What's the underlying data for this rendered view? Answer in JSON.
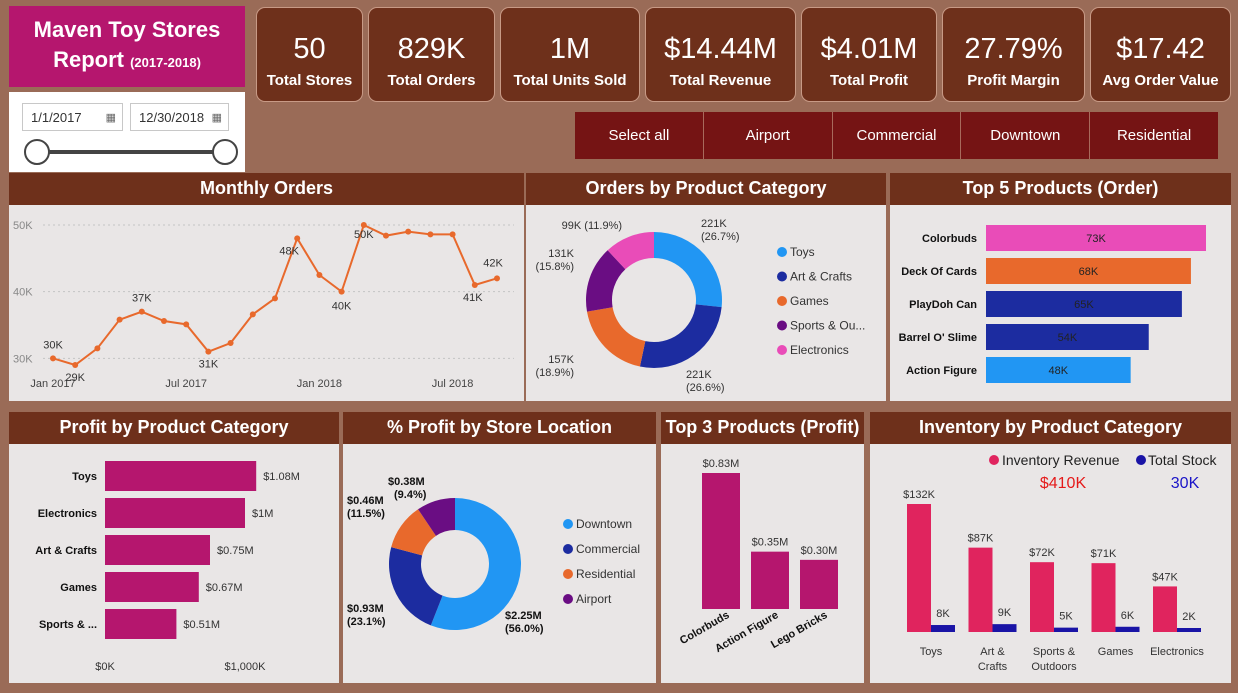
{
  "header": {
    "title_line1": "Maven Toy Stores",
    "title_line2": "Report",
    "title_years": "(2017-2018)"
  },
  "date_filter": {
    "start": "1/1/2017",
    "end": "12/30/2018"
  },
  "kpis": [
    {
      "value": "50",
      "label": "Total Stores"
    },
    {
      "value": "829K",
      "label": "Total Orders"
    },
    {
      "value": "1M",
      "label": "Total Units Sold"
    },
    {
      "value": "$14.44M",
      "label": "Total Revenue"
    },
    {
      "value": "$4.01M",
      "label": "Total Profit"
    },
    {
      "value": "27.79%",
      "label": "Profit Margin"
    },
    {
      "value": "$17.42",
      "label": "Avg Order Value"
    }
  ],
  "location_slicer": [
    "Select all",
    "Airport",
    "Commercial",
    "Downtown",
    "Residential"
  ],
  "colors": {
    "background": "#9a6b57",
    "header_brown": "#6e301b",
    "magenta": "#b5166e",
    "orange": "#e8692c",
    "blue": "#2196f3",
    "navy": "#1c2ca0",
    "purple": "#6a0d83",
    "pink": "#e94cb8",
    "inventory_red": "#e0245e",
    "inventory_navy": "#1a14a6"
  },
  "chart_data": [
    {
      "id": "monthly_orders",
      "type": "line",
      "title": "Monthly Orders",
      "xlabel": "",
      "ylabel": "",
      "x": [
        "2017-01",
        "2017-02",
        "2017-03",
        "2017-04",
        "2017-05",
        "2017-06",
        "2017-07",
        "2017-08",
        "2017-09",
        "2017-10",
        "2017-11",
        "2017-12",
        "2018-01",
        "2018-02",
        "2018-03",
        "2018-04",
        "2018-05",
        "2018-06",
        "2018-07",
        "2018-08",
        "2018-09",
        "2018-10",
        "2018-11",
        "2018-12"
      ],
      "x_tick_labels": [
        "Jan 2017",
        "Jul 2017",
        "Jan 2018",
        "Jul 2018"
      ],
      "values": [
        30,
        29,
        31.5,
        35.8,
        37,
        35.6,
        35.1,
        31,
        32.3,
        36.6,
        39,
        48,
        42.5,
        40,
        50,
        48.4,
        49,
        48.6,
        48.6,
        41,
        42
      ],
      "y_ticks": [
        "30K",
        "40K",
        "50K"
      ],
      "ylim": [
        27.5,
        51.5
      ],
      "data_labels": [
        {
          "index": 0,
          "text": "30K"
        },
        {
          "index": 1,
          "text": "29K"
        },
        {
          "index": 4,
          "text": "37K"
        },
        {
          "index": 7,
          "text": "31K"
        },
        {
          "index": 11,
          "text": "48K"
        },
        {
          "index": 13,
          "text": "40K"
        },
        {
          "index": 14,
          "text": "50K"
        },
        {
          "index": 19,
          "text": "41K"
        },
        {
          "index": 20,
          "text": "42K"
        }
      ]
    },
    {
      "id": "orders_by_category",
      "type": "pie",
      "title": "Orders by Product Category",
      "categories": [
        "Toys",
        "Art & Crafts",
        "Games",
        "Sports & Ou...",
        "Electronics"
      ],
      "values": [
        221,
        221,
        157,
        131,
        99
      ],
      "labels": [
        {
          "value": "221K",
          "pct": "(26.7%)"
        },
        {
          "value": "221K",
          "pct": "(26.6%)"
        },
        {
          "value": "157K",
          "pct": "(18.9%)"
        },
        {
          "value": "131K",
          "pct": "(15.8%)"
        },
        {
          "value": "99K",
          "pct": "(11.9%)"
        }
      ],
      "colors": [
        "#2196f3",
        "#1c2ca0",
        "#e8692c",
        "#6a0d83",
        "#e94cb8"
      ],
      "legend": "right"
    },
    {
      "id": "top5_products_orders",
      "type": "bar",
      "title": "Top 5 Products (Order)",
      "categories": [
        "Colorbuds",
        "Deck Of Cards",
        "PlayDoh Can",
        "Barrel O' Slime",
        "Action Figure"
      ],
      "values": [
        73,
        68,
        65,
        54,
        48
      ],
      "value_labels": [
        "73K",
        "68K",
        "65K",
        "54K",
        "48K"
      ],
      "colors": [
        "#e94cb8",
        "#e8692c",
        "#1c2ca0",
        "#1c2ca0",
        "#2196f3"
      ],
      "orientation": "horizontal"
    },
    {
      "id": "profit_by_category",
      "type": "bar",
      "title": "Profit by Product Category",
      "categories": [
        "Toys",
        "Electronics",
        "Art & Crafts",
        "Games",
        "Sports & ..."
      ],
      "values": [
        1.08,
        1.0,
        0.75,
        0.67,
        0.51
      ],
      "value_labels": [
        "$1.08M",
        "$1M",
        "$0.75M",
        "$0.67M",
        "$0.51M"
      ],
      "x_ticks": [
        "$0K",
        "$1,000K"
      ],
      "xlim": [
        0,
        1.0
      ],
      "orientation": "horizontal"
    },
    {
      "id": "profit_by_location",
      "type": "pie",
      "title": "% Profit by Store Location",
      "categories": [
        "Downtown",
        "Commercial",
        "Residential",
        "Airport"
      ],
      "values": [
        2.25,
        0.93,
        0.46,
        0.38
      ],
      "labels": [
        {
          "value": "$2.25M",
          "pct": "(56.0%)"
        },
        {
          "value": "$0.93M",
          "pct": "(23.1%)"
        },
        {
          "value": "$0.46M",
          "pct": "(11.5%)"
        },
        {
          "value": "$0.38M",
          "pct": "(9.4%)"
        }
      ],
      "colors": [
        "#2196f3",
        "#1c2ca0",
        "#e8692c",
        "#6a0d83"
      ],
      "legend": "right"
    },
    {
      "id": "top3_products_profit",
      "type": "bar",
      "title": "Top 3 Products (Profit)",
      "categories": [
        "Colorbuds",
        "Action Figure",
        "Lego Bricks"
      ],
      "values": [
        0.83,
        0.35,
        0.3
      ],
      "value_labels": [
        "$0.83M",
        "$0.35M",
        "$0.30M"
      ],
      "orientation": "vertical"
    },
    {
      "id": "inventory_by_category",
      "type": "bar",
      "title": "Inventory by Product Category",
      "categories": [
        "Toys",
        "Art & Crafts",
        "Sports & Outdoors",
        "Games",
        "Electronics"
      ],
      "category_lines": [
        [
          "Toys"
        ],
        [
          "Art &",
          "Crafts"
        ],
        [
          "Sports &",
          "Outdoors"
        ],
        [
          "Games"
        ],
        [
          "Electronics"
        ]
      ],
      "series": [
        {
          "name": "Inventory Revenue",
          "values": [
            132,
            87,
            72,
            71,
            47
          ],
          "labels": [
            "$132K",
            "$87K",
            "$72K",
            "$71K",
            "$47K"
          ],
          "total": "$410K",
          "color": "#e0245e"
        },
        {
          "name": "Total Stock",
          "values": [
            8,
            9,
            5,
            6,
            2
          ],
          "labels": [
            "8K",
            "9K",
            "5K",
            "6K",
            "2K"
          ],
          "total": "30K",
          "color": "#1a14a6"
        }
      ],
      "orientation": "vertical",
      "legend": "top"
    }
  ]
}
